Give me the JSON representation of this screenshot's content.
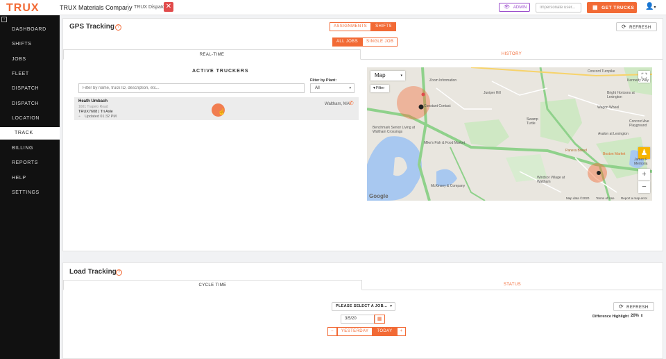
{
  "topbar": {
    "logo": "TRUX",
    "company": "TRUX Materials Company",
    "dispatch": "TRUX Dispatch",
    "admin_label": "ADMIN",
    "impersonate_placeholder": "Impersonate user...",
    "get_trucks": "GET TRUCKS",
    "brand_color": "#f26a35"
  },
  "sidebar": {
    "items": [
      {
        "label": "DASHBOARD"
      },
      {
        "label": "SHIFTS"
      },
      {
        "label": "JOBS"
      },
      {
        "label": "FLEET"
      },
      {
        "label": "DISPATCH"
      },
      {
        "label": "DISPATCH"
      },
      {
        "label": "LOCATION"
      },
      {
        "label": "TRACK"
      },
      {
        "label": "BILLING"
      },
      {
        "label": "REPORTS"
      },
      {
        "label": "HELP"
      },
      {
        "label": "SETTINGS"
      }
    ]
  },
  "gps": {
    "title": "GPS Tracking",
    "toggle": [
      "ASSIGNMENTS",
      "SHIFTS"
    ],
    "jobs_toggle": [
      "ALL JOBS",
      "SINGLE JOB"
    ],
    "refresh": "REFRESH",
    "tabs": [
      "REAL-TIME",
      "HISTORY"
    ],
    "active_truckers": "ACTIVE TRUCKERS",
    "search_placeholder": "Filter by name, truck ID, description, etc...",
    "filter_label": "Filter by Plant:",
    "filter_value": "All",
    "trucker": {
      "name": "Heath Umbach",
      "address": "1601 Trapelo Road",
      "truck": "TRUX7608 | Tri Axle",
      "updated": "Updated 01:32 PM",
      "location": "Waltham, MA"
    }
  },
  "map": {
    "type": "Map",
    "filter": "Filter",
    "labels": {
      "zoom": "Zoom Information",
      "juniper": "Juniper Hill",
      "constant": "Constant Contact",
      "benchmark": "Benchmark Senior Living at Waltham Crossings",
      "mike": "Mike's Fish & Food Market",
      "mckinsey": "McKinsey & Company",
      "swamp": "Swamp Turtle",
      "bright": "Bright Horizons at Lexington",
      "wagon": "Wagon Wheel",
      "avalon": "Avalon at Lexington",
      "panera": "Panera Bread",
      "boston": "Boston Market",
      "windsor": "Windsor Village at Waltham",
      "concord": "Concord Ave Playground",
      "turnpike": "Concord Turnpike",
      "james": "James F Memoria",
      "kennedy": "Kennedy Way"
    },
    "footer": {
      "data": "Map data ©2020",
      "terms": "Terms of Use",
      "report": "Report a map error"
    },
    "google": "Google"
  },
  "load": {
    "title": "Load Tracking",
    "tabs": [
      "CYCLE TIME",
      "STATUS"
    ],
    "job_select": "PLEASE SELECT A JOB...",
    "refresh": "REFRESH",
    "diff_label": "Difference Highlight",
    "diff_value": "20%",
    "date": "3/5/20",
    "yesterday": "YESTERDAY",
    "today": "TODAY"
  }
}
